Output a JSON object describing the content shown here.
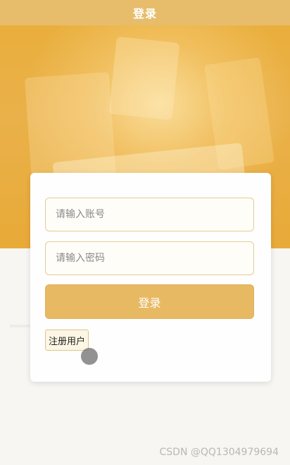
{
  "header": {
    "title": "登录"
  },
  "login_form": {
    "account_placeholder": "请输入账号",
    "password_placeholder": "请输入密码",
    "login_label": "登录",
    "register_label": "注册用户"
  },
  "watermark": "CSDN @QQ1304979694",
  "colors": {
    "brand": "#e7bd6c",
    "banner": "#e9ae3c",
    "input_border": "#e2cd95"
  }
}
